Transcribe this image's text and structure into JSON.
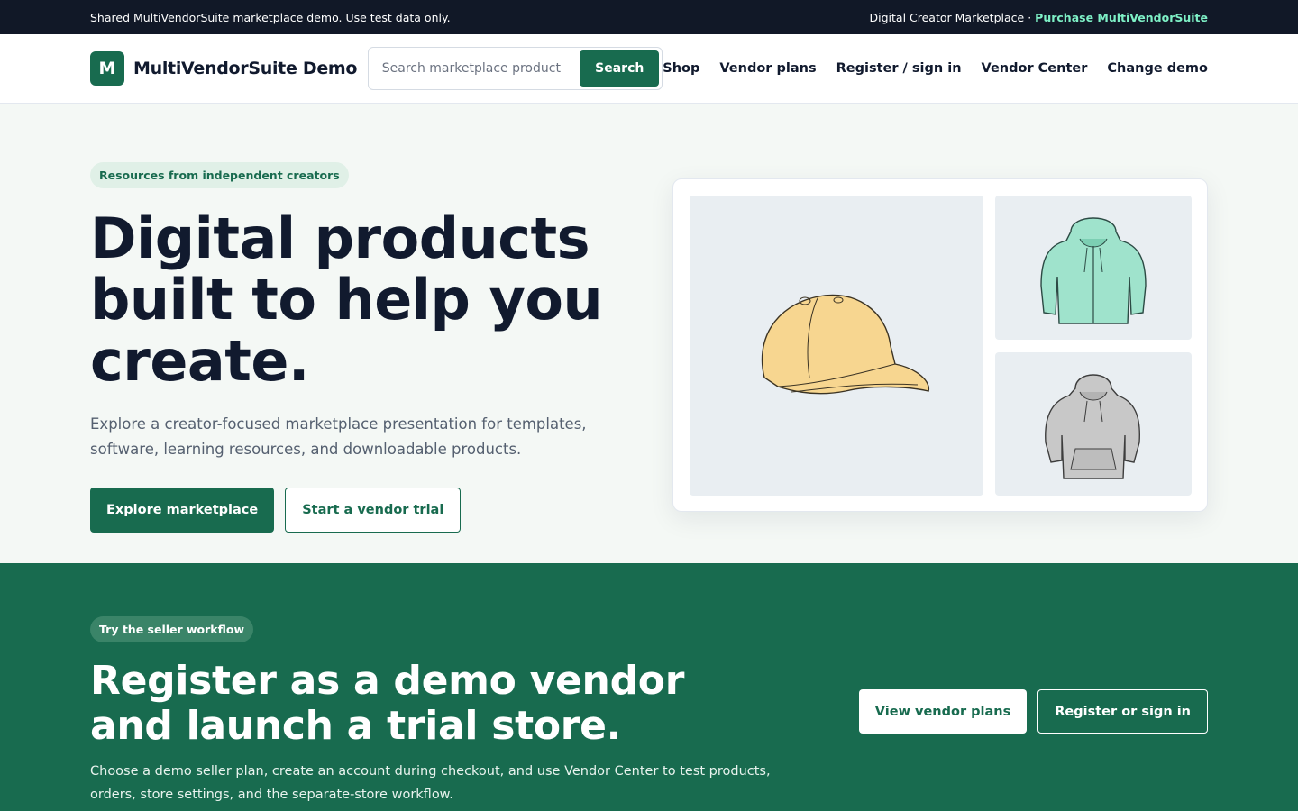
{
  "topbar": {
    "notice": "Shared MultiVendorSuite marketplace demo. Use test data only.",
    "tagline": "Digital Creator Marketplace ·",
    "purchase_link": "Purchase MultiVendorSuite"
  },
  "header": {
    "logo_letter": "M",
    "brand_name": "MultiVendorSuite Demo",
    "search_placeholder": "Search marketplace product",
    "search_button": "Search",
    "nav": [
      "Shop",
      "Vendor plans",
      "Register / sign in",
      "Vendor Center",
      "Change demo"
    ]
  },
  "hero": {
    "badge": "Resources from independent creators",
    "title": "Digital products built to help you create.",
    "description": "Explore a creator-focused marketplace presentation for templates, software, learning resources, and downloadable products.",
    "primary_button": "Explore marketplace",
    "secondary_button": "Start a vendor trial",
    "gallery": [
      "cap-illustration",
      "mint-zip-hoodie-illustration",
      "grey-pullover-hoodie-illustration"
    ]
  },
  "vendor": {
    "badge": "Try the seller workflow",
    "title": "Register as a demo vendor and launch a trial store.",
    "description": "Choose a demo seller plan, create an account during checkout, and use Vendor Center to test products, orders, store settings, and the separate-store workflow.",
    "plans_button": "View vendor plans",
    "register_button": "Register or sign in"
  },
  "colors": {
    "brand_green": "#186b4f",
    "topbar_bg": "#111827",
    "accent_link": "#7ef0c6",
    "hero_bg": "#f4f8f5"
  }
}
